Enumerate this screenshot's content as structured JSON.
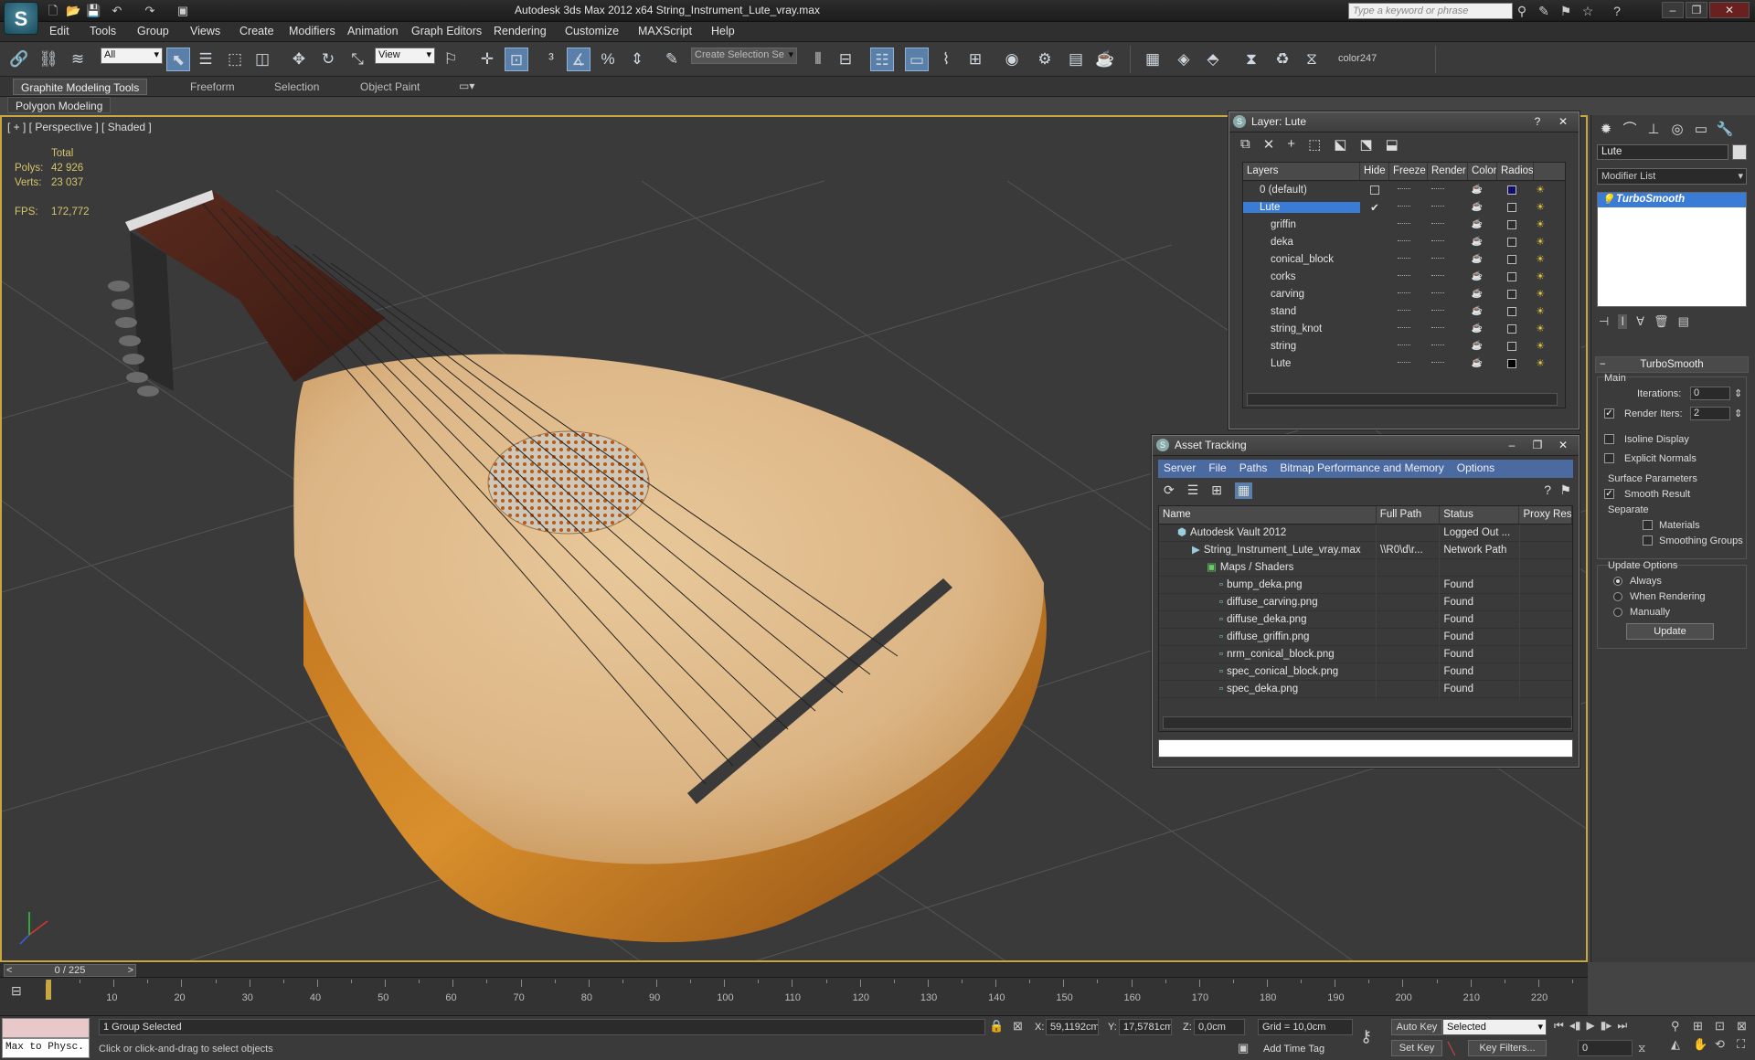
{
  "app": {
    "logo_letter": "S",
    "title": "Autodesk 3ds Max  2012 x64      String_Instrument_Lute_vray.max",
    "search_placeholder": "Type a keyword or phrase"
  },
  "menu": [
    "Edit",
    "Tools",
    "Group",
    "Views",
    "Create",
    "Modifiers",
    "Animation",
    "Graph Editors",
    "Rendering",
    "Customize",
    "MAXScript",
    "Help"
  ],
  "toolbar": {
    "filter_select": "All",
    "coord_select": "View",
    "selection_set_placeholder": "Create Selection Se",
    "color_label": "color247"
  },
  "ribbon": {
    "tabs": [
      "Graphite Modeling Tools",
      "Freeform",
      "Selection",
      "Object Paint"
    ],
    "sub_label": "Polygon Modeling"
  },
  "viewport": {
    "label": "[ + ] [ Perspective ] [ Shaded ]",
    "stats": {
      "total_label": "Total",
      "polys_label": "Polys:",
      "polys": "42 926",
      "verts_label": "Verts:",
      "verts": "23 037",
      "fps_label": "FPS:",
      "fps": "172,772"
    }
  },
  "layer_window": {
    "title": "Layer: Lute",
    "columns": [
      "Layers",
      "Hide",
      "Freeze",
      "Render",
      "Color",
      "Radios"
    ],
    "layers": [
      {
        "name": "0 (default)",
        "color": "#10106a"
      },
      {
        "name": "Lute",
        "color": "#2e2e2e"
      },
      {
        "name": "griffin",
        "color": "#2e2e2e"
      },
      {
        "name": "deka",
        "color": "#2e2e2e"
      },
      {
        "name": "conical_block",
        "color": "#2e2e2e"
      },
      {
        "name": "corks",
        "color": "#2e2e2e"
      },
      {
        "name": "carving",
        "color": "#2e2e2e"
      },
      {
        "name": "stand",
        "color": "#2e2e2e"
      },
      {
        "name": "string_knot",
        "color": "#2e2e2e"
      },
      {
        "name": "string",
        "color": "#2e2e2e"
      },
      {
        "name": "Lute",
        "color": "#000000"
      }
    ]
  },
  "asset_window": {
    "title": "Asset Tracking",
    "menu": [
      "Server",
      "File",
      "Paths",
      "Bitmap Performance and Memory",
      "Options"
    ],
    "columns": [
      "Name",
      "Full Path",
      "Status",
      "Proxy Res"
    ],
    "rows": [
      {
        "name": "Autodesk Vault 2012",
        "path": "",
        "status": "Logged Out ..."
      },
      {
        "name": "String_Instrument_Lute_vray.max",
        "path": "\\\\R0\\d\\r...",
        "status": "Network Path"
      },
      {
        "name": "Maps / Shaders",
        "path": "",
        "status": ""
      },
      {
        "name": "bump_deka.png",
        "path": "",
        "status": "Found"
      },
      {
        "name": "diffuse_carving.png",
        "path": "",
        "status": "Found"
      },
      {
        "name": "diffuse_deka.png",
        "path": "",
        "status": "Found"
      },
      {
        "name": "diffuse_griffin.png",
        "path": "",
        "status": "Found"
      },
      {
        "name": "nrm_conical_block.png",
        "path": "",
        "status": "Found"
      },
      {
        "name": "spec_conical_block.png",
        "path": "",
        "status": "Found"
      },
      {
        "name": "spec_deka.png",
        "path": "",
        "status": "Found"
      }
    ]
  },
  "command_panel": {
    "object_name": "Lute",
    "modifier_list": "Modifier List",
    "modifier": "TurboSmooth",
    "rollout_title": "TurboSmooth",
    "main_label": "Main",
    "iterations_label": "Iterations:",
    "iterations": "0",
    "render_iters_label": "Render Iters:",
    "render_iters": "2",
    "isoline_label": "Isoline Display",
    "explicit_normals_label": "Explicit Normals",
    "surface_params_label": "Surface Parameters",
    "smooth_result_label": "Smooth Result",
    "separate_label": "Separate",
    "materials_label": "Materials",
    "smoothing_groups_label": "Smoothing Groups",
    "update_options_label": "Update Options",
    "always_label": "Always",
    "when_rendering_label": "When Rendering",
    "manually_label": "Manually",
    "update_button": "Update"
  },
  "timeline": {
    "frame": "0 / 225",
    "ticks": [
      "10",
      "20",
      "30",
      "40",
      "50",
      "60",
      "70",
      "80",
      "90",
      "100",
      "110",
      "120",
      "130",
      "140",
      "150",
      "160",
      "170",
      "180",
      "190",
      "200",
      "210",
      "220"
    ]
  },
  "status": {
    "listener": "Max to Physc.",
    "selection": "1 Group Selected",
    "prompt": "Click or click-and-drag to select objects",
    "x_label": "X:",
    "x": "59,1192cm",
    "y_label": "Y:",
    "y": "17,5781cm",
    "z_label": "Z:",
    "z": "0,0cm",
    "grid": "Grid = 10,0cm",
    "auto_key": "Auto Key",
    "set_key": "Set Key",
    "selected": "Selected",
    "key_filters": "Key Filters...",
    "add_time_tag": "Add Time Tag",
    "frame_field": "0"
  }
}
